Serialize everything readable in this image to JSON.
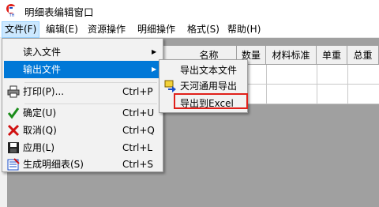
{
  "window": {
    "title": "明细表编辑窗口"
  },
  "menubar": {
    "items": [
      "文件(F)",
      "编辑(E)",
      "资源操作",
      "明细操作",
      "格式(S)",
      "帮助(H)"
    ]
  },
  "grid": {
    "columns": [
      "名称",
      "数量",
      "材料标准",
      "单重",
      "总重"
    ]
  },
  "file_menu": {
    "items": [
      {
        "label": "读入文件",
        "shortcut": "",
        "arrow": "▶",
        "icon": ""
      },
      {
        "label": "输出文件",
        "shortcut": "",
        "arrow": "▶",
        "icon": ""
      },
      {
        "label": "打印(P)...",
        "shortcut": "Ctrl+P",
        "arrow": "",
        "icon": "printer-icon"
      },
      {
        "label": "确定(U)",
        "shortcut": "Ctrl+U",
        "arrow": "",
        "icon": "check-icon"
      },
      {
        "label": "取消(Q)",
        "shortcut": "Ctrl+Q",
        "arrow": "",
        "icon": "cancel-icon"
      },
      {
        "label": "应用(L)",
        "shortcut": "Ctrl+L",
        "arrow": "",
        "icon": "save-icon"
      },
      {
        "label": "生成明细表(S)",
        "shortcut": "Ctrl+S",
        "arrow": "",
        "icon": "generate-icon"
      }
    ],
    "highlighted_index": 1
  },
  "export_submenu": {
    "items": [
      {
        "label": "导出文本文件",
        "icon": ""
      },
      {
        "label": "天河通用导出",
        "icon": "export-icon"
      },
      {
        "label": "导出到Excel",
        "icon": ""
      }
    ],
    "marked_index": 2
  },
  "colors": {
    "highlight": "#0078d7",
    "menu_bg": "#f2f2f2",
    "workspace": "#a0a0a0",
    "annotation_red": "#e0201a"
  }
}
